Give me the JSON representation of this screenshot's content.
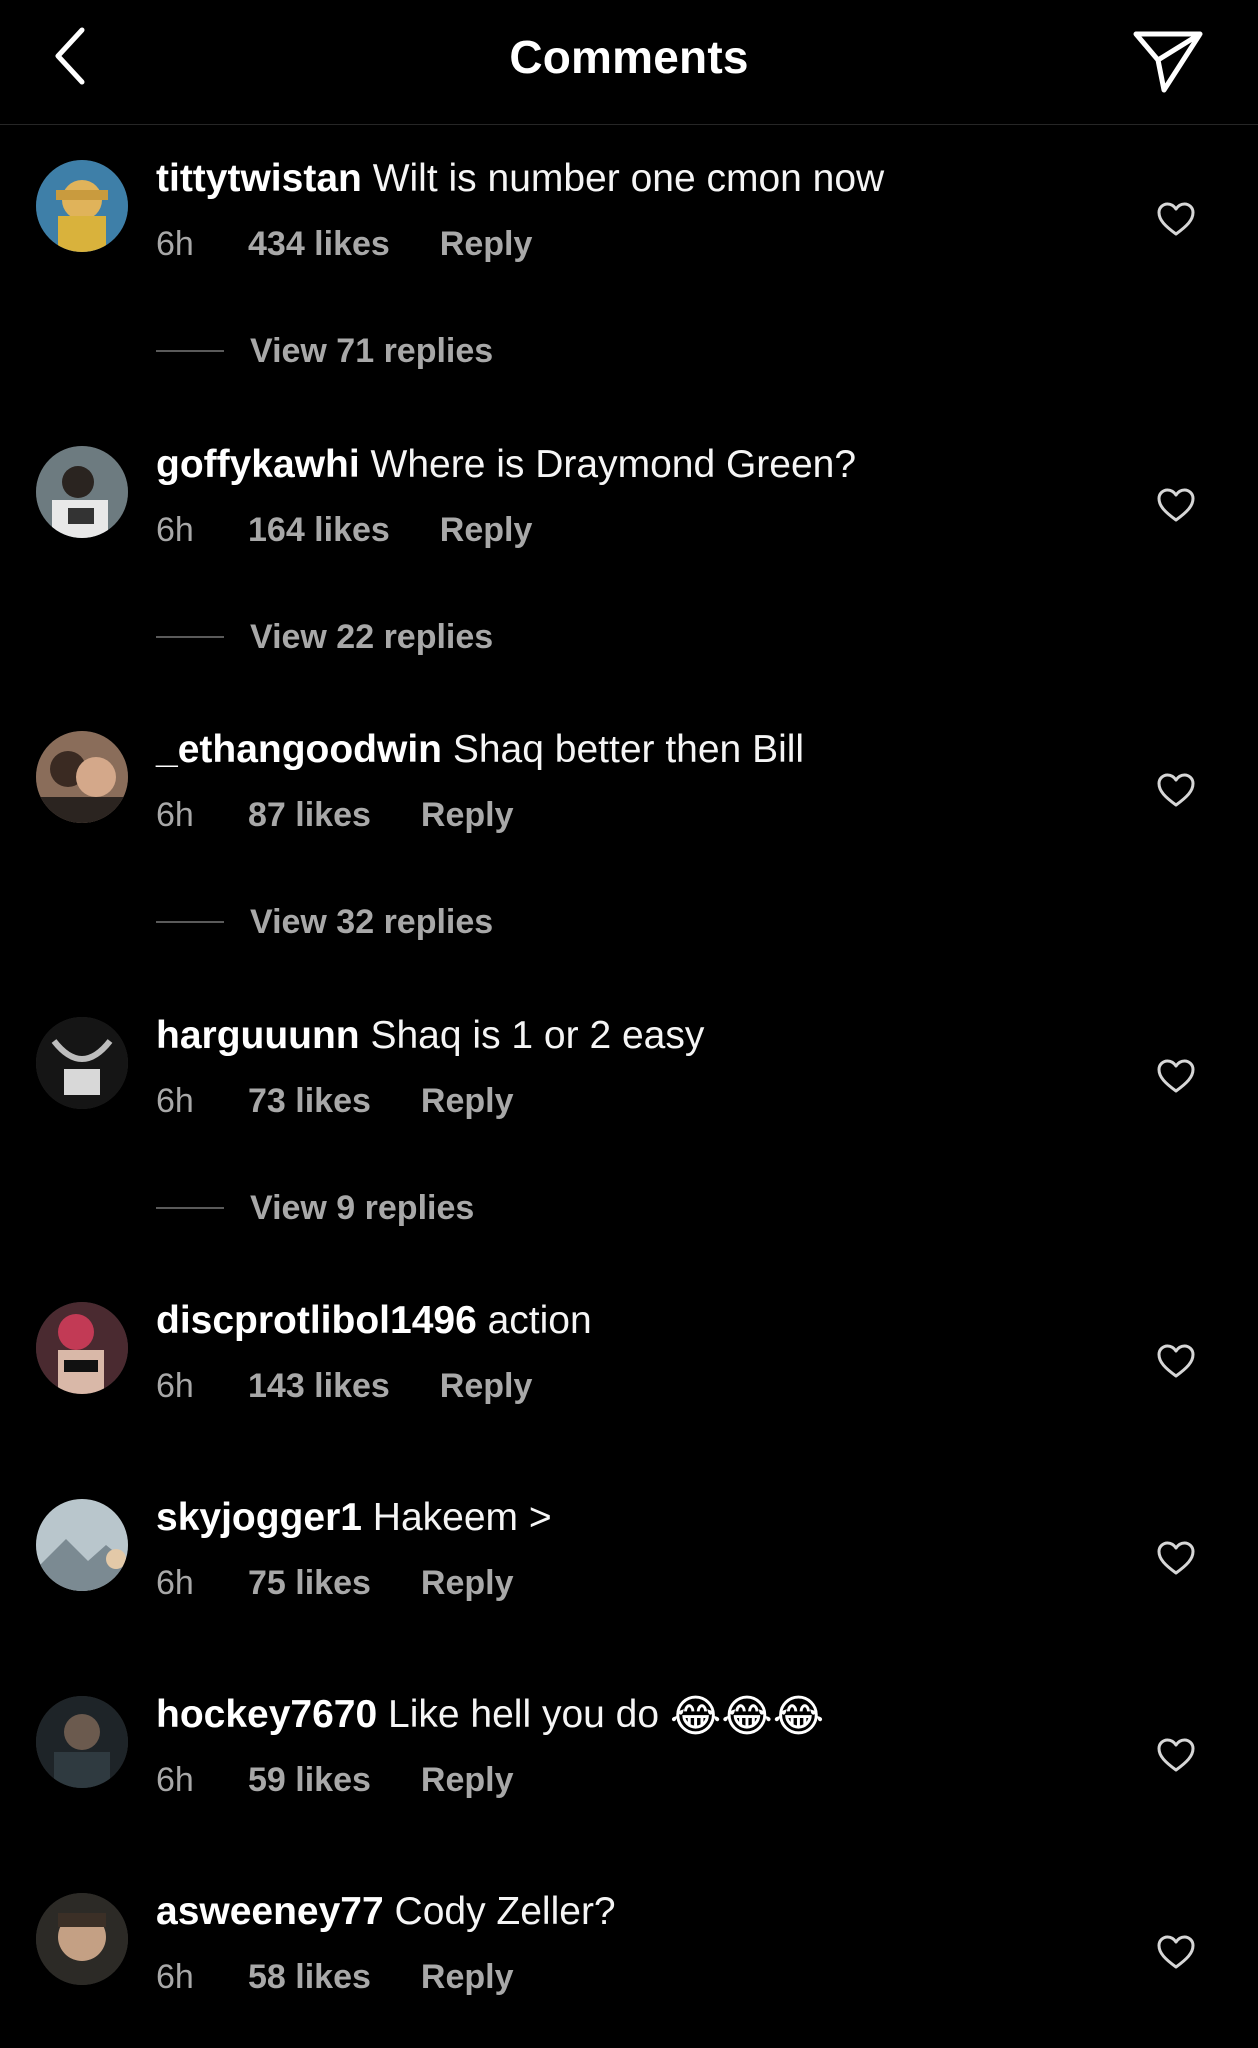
{
  "header": {
    "title": "Comments",
    "back_icon": "chevron-left-icon",
    "send_icon": "paper-plane-icon"
  },
  "comments": [
    {
      "username": "tittytwistan",
      "text": "Wilt is number one cmon now",
      "time": "6h",
      "likes": "434 likes",
      "reply": "Reply",
      "view_replies": "View 71 replies"
    },
    {
      "username": "goffykawhi",
      "text": "Where is  Draymond Green?",
      "time": "6h",
      "likes": "164 likes",
      "reply": "Reply",
      "view_replies": "View 22 replies"
    },
    {
      "username": "_ethangoodwin",
      "text": "Shaq better then Bill",
      "time": "6h",
      "likes": "87 likes",
      "reply": "Reply",
      "view_replies": "View 32 replies"
    },
    {
      "username": "harguuunn",
      "text": "Shaq is 1 or 2 easy",
      "time": "6h",
      "likes": "73 likes",
      "reply": "Reply",
      "view_replies": "View 9 replies"
    },
    {
      "username": "discprotlibol1496",
      "text": "action",
      "time": "6h",
      "likes": "143 likes",
      "reply": "Reply"
    },
    {
      "username": "skyjogger1",
      "text": "Hakeem >",
      "time": "6h",
      "likes": "75 likes",
      "reply": "Reply"
    },
    {
      "username": "hockey7670",
      "text": "Like hell you do",
      "emoji": "😂😂😂",
      "time": "6h",
      "likes": "59 likes",
      "reply": "Reply"
    },
    {
      "username": "asweeney77",
      "text": "Cody Zeller?",
      "time": "6h",
      "likes": "58 likes",
      "reply": "Reply"
    }
  ],
  "colors": {
    "background": "#000000",
    "primary_text": "#ffffff",
    "secondary_text": "#a8a8a8"
  },
  "icons": {
    "like": "heart-outline-icon"
  }
}
